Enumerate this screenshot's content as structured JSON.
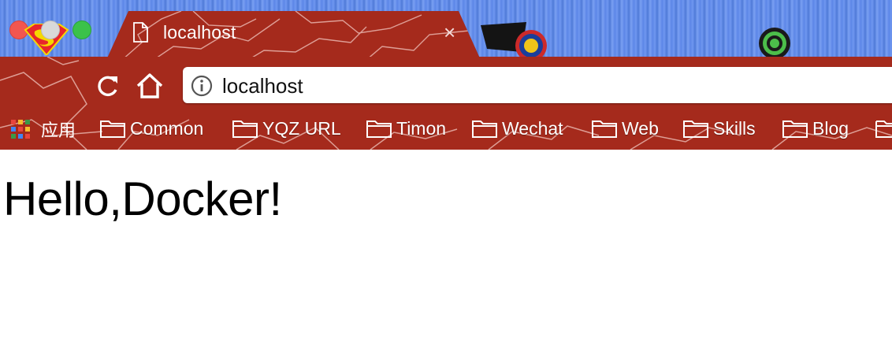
{
  "tab": {
    "title": "localhost",
    "close_glyph": "×"
  },
  "toolbar": {
    "url": "localhost",
    "reload_icon": "reload-icon",
    "home_icon": "home-icon",
    "info_icon": "info-icon"
  },
  "bookmarks": {
    "apps_label": "应用",
    "items": [
      {
        "label": "Common"
      },
      {
        "label": "YQZ URL"
      },
      {
        "label": "Timon"
      },
      {
        "label": "Wechat"
      },
      {
        "label": "Web"
      },
      {
        "label": "Skills"
      },
      {
        "label": "Blog"
      }
    ]
  },
  "page": {
    "heading": "Hello,Docker!"
  },
  "colors": {
    "theme_red": "#a52a1c",
    "tabstrip_blue": "#5a85e6",
    "close": "#f2564f",
    "minimize": "#d9d9d9",
    "maximize": "#3bc24a"
  }
}
